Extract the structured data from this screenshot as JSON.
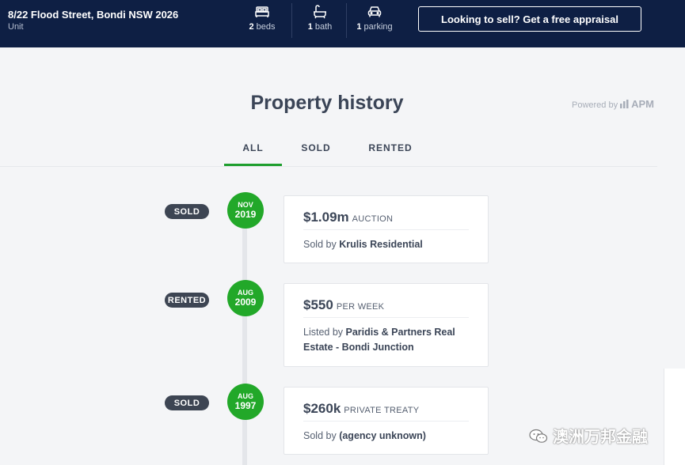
{
  "header": {
    "address": "8/22 Flood Street, Bondi NSW 2026",
    "property_type": "Unit",
    "features": [
      {
        "icon": "bed-icon",
        "count": "2",
        "label": "beds"
      },
      {
        "icon": "bath-icon",
        "count": "1",
        "label": "bath"
      },
      {
        "icon": "car-icon",
        "count": "1",
        "label": "parking"
      }
    ],
    "cta_label": "Looking to sell? Get a free appraisal"
  },
  "section": {
    "title": "Property history",
    "powered_by": "Powered by",
    "powered_brand": "APM"
  },
  "tabs": [
    {
      "label": "ALL",
      "active": true
    },
    {
      "label": "SOLD",
      "active": false
    },
    {
      "label": "RENTED",
      "active": false
    }
  ],
  "history": [
    {
      "badge": "SOLD",
      "month": "NOV",
      "year": "2019",
      "price": "$1.09m",
      "method": "AUCTION",
      "by_prefix": "Sold by",
      "agency": "Krulis Residential"
    },
    {
      "badge": "RENTED",
      "month": "AUG",
      "year": "2009",
      "price": "$550",
      "method": "PER WEEK",
      "by_prefix": "Listed by",
      "agency": "Paridis & Partners Real Estate - Bondi Junction"
    },
    {
      "badge": "SOLD",
      "month": "AUG",
      "year": "1997",
      "price": "$260k",
      "method": "PRIVATE TREATY",
      "by_prefix": "Sold by",
      "agency": "(agency unknown)"
    }
  ],
  "colors": {
    "header_bg": "#0e1f44",
    "accent_green": "#22a829",
    "badge_bg": "#3d4553"
  },
  "watermark": "澳洲万邦金融"
}
